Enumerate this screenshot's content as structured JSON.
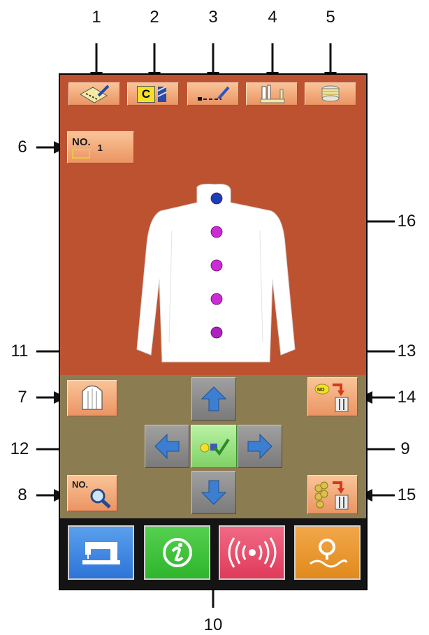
{
  "callouts": {
    "n1": "1",
    "n2": "2",
    "n3": "3",
    "n4": "4",
    "n5": "5",
    "n6": "6",
    "n7": "7",
    "n8": "8",
    "n9": "9",
    "n10": "10",
    "n11": "11",
    "n12": "12",
    "n13": "13",
    "n14": "14",
    "n15": "15",
    "n16": "16"
  },
  "top_toolbar": {
    "data_input_icon": "data-input-icon",
    "counter_c_label": "C",
    "stitch_icon": "stitch-setting-icon",
    "presser_icon": "presser-foot-icon",
    "bobbin_icon": "bobbin-winder-icon"
  },
  "pattern_no": {
    "no_label": "NO.",
    "value": "1"
  },
  "preview": {
    "button_count": 5,
    "button_colors": [
      "#1a3fb8",
      "#cc2bd6",
      "#cc2bd6",
      "#cc2bd6",
      "#b01fc0"
    ]
  },
  "search_no": {
    "no_label": "NO."
  },
  "bottom_bar": {
    "sewing_icon": "sewing-machine-icon",
    "info_icon": "information-icon",
    "comm_icon": "communication-icon",
    "search_icon": "search-icon"
  },
  "colors": {
    "screen_top": "#bd5231",
    "screen_mid": "#8c7c52",
    "sew_button": "#2d74d9",
    "info_button": "#2fb52b",
    "comm_button": "#e03a5a",
    "search_button": "#e08a1c"
  }
}
